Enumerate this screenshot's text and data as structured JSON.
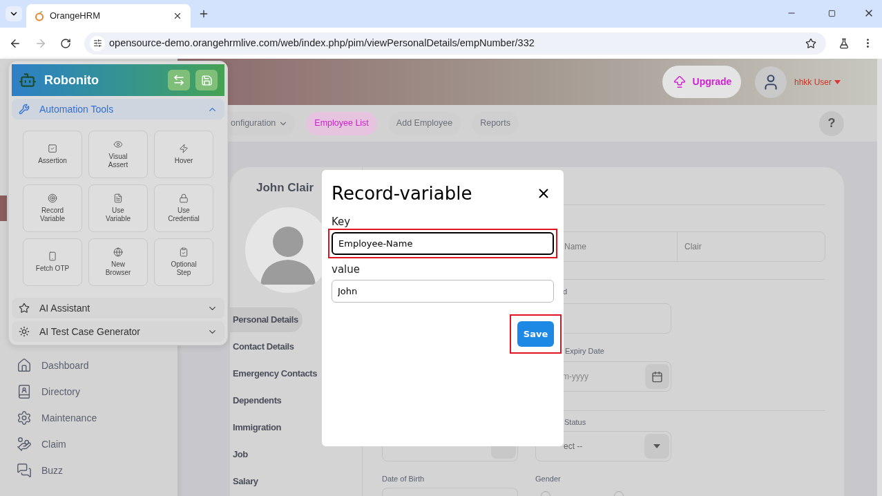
{
  "browser": {
    "tab_title": "OrangeHRM",
    "url": "opensource-demo.orangehrmlive.com/web/index.php/pim/viewPersonalDetails/empNumber/332",
    "forward_disabled": true
  },
  "header": {
    "upgrade": "Upgrade",
    "user": "hhkk User"
  },
  "top_nav": [
    {
      "label": "onfiguration",
      "dropdown": true,
      "selected": false
    },
    {
      "label": "Employee List",
      "dropdown": false,
      "selected": true
    },
    {
      "label": "Add Employee",
      "dropdown": false,
      "selected": false
    },
    {
      "label": "Reports",
      "dropdown": false,
      "selected": false
    }
  ],
  "help": "?",
  "sidebar": {
    "items": [
      {
        "label": "Dashboard"
      },
      {
        "label": "Directory"
      },
      {
        "label": "Maintenance"
      },
      {
        "label": "Claim"
      },
      {
        "label": "Buzz"
      }
    ]
  },
  "employee": {
    "name": "John Clair",
    "tabs": [
      {
        "label": "Personal Details",
        "selected": true
      },
      {
        "label": "Contact Details",
        "selected": false
      },
      {
        "label": "Emergency Contacts",
        "selected": false
      },
      {
        "label": "Dependents",
        "selected": false
      },
      {
        "label": "Immigration",
        "selected": false
      },
      {
        "label": "Job",
        "selected": false
      },
      {
        "label": "Salary",
        "selected": false
      }
    ]
  },
  "form": {
    "name_parts": [
      "Name",
      "Clair"
    ],
    "other_id_label": "d",
    "expiry_label": "Expiry Date",
    "expiry_placeholder": "m-yyyy",
    "status_label": "Status",
    "status_value": "ect --",
    "dob_label": "Date of Birth",
    "gender_label": "Gender",
    "gender_radios": [
      {
        "checked": false
      },
      {
        "checked": false
      }
    ]
  },
  "robonito": {
    "title": "Robonito",
    "sections": [
      {
        "title": "Automation Tools",
        "expanded": true,
        "tools": [
          "Assertion",
          "Visual Assert",
          "Hover",
          "Record Variable",
          "Use Variable",
          "Use Credential",
          "Fetch OTP",
          "New Browser",
          "Optional Step"
        ]
      },
      {
        "title": "AI Assistant",
        "expanded": false
      },
      {
        "title": "AI Test Case Generator",
        "expanded": false
      }
    ]
  },
  "dialog": {
    "title": "Record-variable",
    "fields": [
      {
        "label": "Key",
        "value": "Employee-Name",
        "focused": true,
        "highlighted": true
      },
      {
        "label": "value",
        "value": "John",
        "focused": false,
        "highlighted": false
      }
    ],
    "save": {
      "label": "Save",
      "highlighted": true
    }
  }
}
